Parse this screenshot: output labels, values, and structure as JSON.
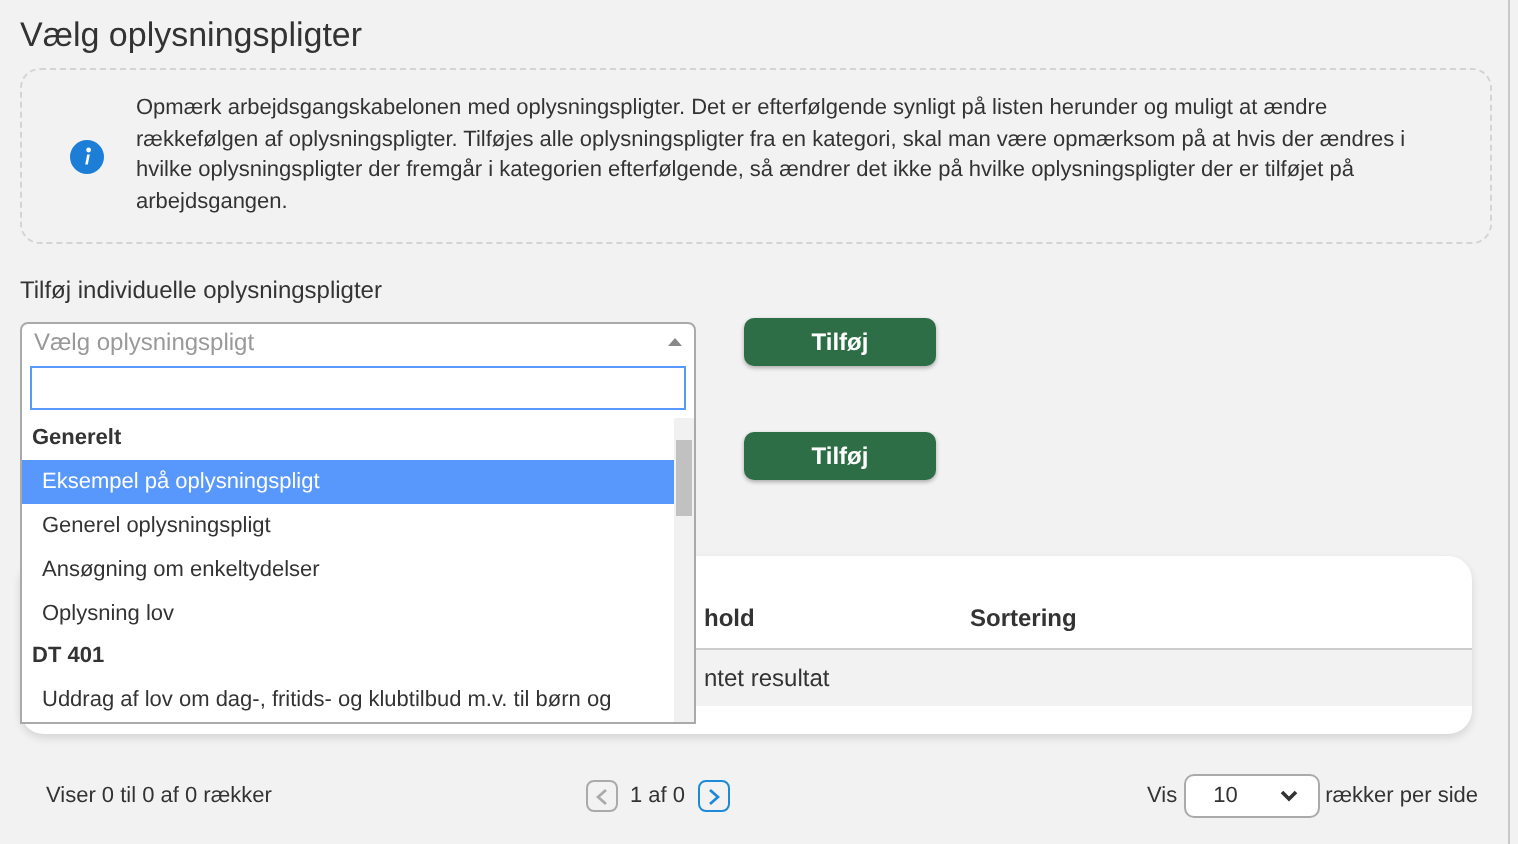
{
  "title": "Vælg oplysningspligter",
  "info": {
    "text": "Opmærk arbejdsgangskabelonen med oplysningspligter. Det er efterfølgende synligt på listen herunder og muligt at ændre rækkefølgen af oplysningspligter. Tilføjes alle oplysningspligter fra en kategori, skal man være opmærksom på at hvis der ændres i hvilke oplysningspligter der fremgår i kategorien efterfølgende, så ændrer det ikke på hvilke oplysningspligter der er tilføjet på arbejdsgangen."
  },
  "individual": {
    "label": "Tilføj individuelle oplysningspligter",
    "placeholder": "Vælg oplysningspligt",
    "expanded": true,
    "button": "Tilføj"
  },
  "category": {
    "button": "Tilføj"
  },
  "dropdown": {
    "groups": [
      {
        "label": "Generelt",
        "options": [
          {
            "label": "Eksempel på oplysningspligt",
            "selected": true
          },
          {
            "label": "Generel oplysningspligt",
            "selected": false
          },
          {
            "label": "Ansøgning om enkeltydelser",
            "selected": false
          },
          {
            "label": "Oplysning lov",
            "selected": false
          }
        ]
      },
      {
        "label": "DT 401",
        "options": [
          {
            "label": "Uddrag af lov om dag-, fritids- og klubtilbud m.v. til børn og",
            "selected": false
          }
        ]
      }
    ]
  },
  "table": {
    "columns": [
      "hold",
      "Sortering"
    ],
    "empty_text": "ntet resultat"
  },
  "footer": {
    "summary": "Viser 0 til 0 af 0 rækker",
    "pager": {
      "prev_disabled": true,
      "page": "1 af 0",
      "next_disabled": false
    },
    "page_size": {
      "label": "Vis",
      "value": "10",
      "suffix": "rækker per side"
    }
  }
}
